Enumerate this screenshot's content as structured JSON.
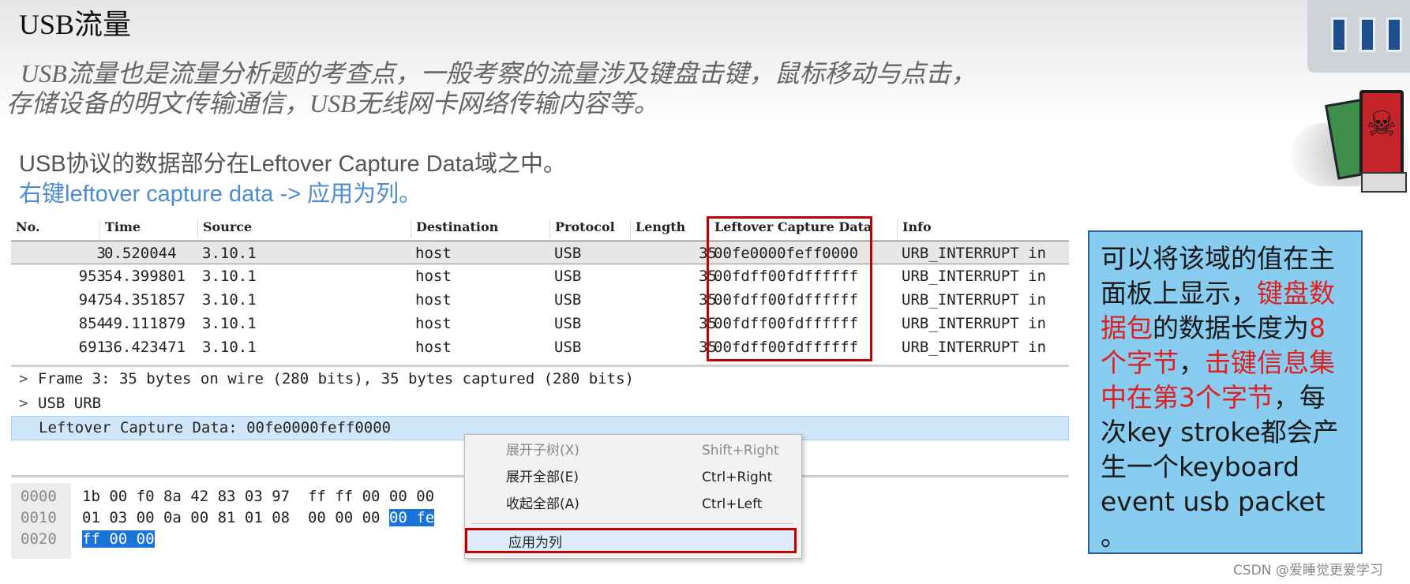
{
  "slide": {
    "title": "USB流量",
    "subtitle_line1": "USB流量也是流量分析题的考查点，一般考察的流量涉及键盘击键，鼠标移动与点击，",
    "subtitle_line2": "存储设备的明文传输通信，USB无线网卡网络传输内容等。",
    "note1": "USB协议的数据部分在Leftover Capture Data域之中。",
    "note2": "右键leftover capture data -> 应用为列。"
  },
  "packet_list": {
    "columns": [
      "No.",
      "Time",
      "Source",
      "Destination",
      "Protocol",
      "Length",
      "Leftover Capture Data",
      "Info"
    ],
    "rows": [
      {
        "no": "3",
        "time": "0.520044",
        "source": "3.10.1",
        "destination": "host",
        "protocol": "USB",
        "length": "35",
        "data": "00fe0000feff0000",
        "info": "URB_INTERRUPT in",
        "selected": true
      },
      {
        "no": "953",
        "time": "54.399801",
        "source": "3.10.1",
        "destination": "host",
        "protocol": "USB",
        "length": "35",
        "data": "00fdff00fdffffff",
        "info": "URB_INTERRUPT in",
        "selected": false
      },
      {
        "no": "947",
        "time": "54.351857",
        "source": "3.10.1",
        "destination": "host",
        "protocol": "USB",
        "length": "35",
        "data": "00fdff00fdffffff",
        "info": "URB_INTERRUPT in",
        "selected": false
      },
      {
        "no": "854",
        "time": "49.111879",
        "source": "3.10.1",
        "destination": "host",
        "protocol": "USB",
        "length": "35",
        "data": "00fdff00fdffffff",
        "info": "URB_INTERRUPT in",
        "selected": false
      },
      {
        "no": "691",
        "time": "36.423471",
        "source": "3.10.1",
        "destination": "host",
        "protocol": "USB",
        "length": "35",
        "data": "00fdff00fdffffff",
        "info": "URB_INTERRUPT in",
        "selected": false
      }
    ]
  },
  "detail_tree": {
    "frame": "Frame 3: 35 bytes on wire (280 bits), 35 bytes captured (280 bits)",
    "usb_urb": "USB URB",
    "leftover": "Leftover Capture Data: 00fe0000feff0000",
    "expand_arrow": ">"
  },
  "hex_dump": [
    {
      "offset": "0000",
      "bytes": "1b 00 f0 8a 42 83 03 97  ff ff 00 00 00",
      "selected": ""
    },
    {
      "offset": "0010",
      "bytes": "01 03 00 0a 00 81 01 08  00 00 00 ",
      "selected": "00 fe"
    },
    {
      "offset": "0020",
      "bytes": "",
      "selected": "ff 00 00"
    }
  ],
  "context_menu": {
    "items": [
      {
        "label": "展开子树(X)",
        "shortcut": "Shift+Right",
        "disabled": true
      },
      {
        "label": "展开全部(E)",
        "shortcut": "Ctrl+Right",
        "disabled": false
      },
      {
        "label": "收起全部(A)",
        "shortcut": "Ctrl+Left",
        "disabled": false
      }
    ],
    "apply_as_column": "应用为列"
  },
  "note_box": {
    "p1": "可以将该域的值在主面板上显示，",
    "p2_red": "键盘数据包",
    "p3": "的数据长度为",
    "p4_red": "8个字节",
    "p5": "，",
    "p6_red": "击键信息集中在第3个字节",
    "p7": "，每次key stroke都会产生一个keyboard event usb packet 。"
  },
  "watermark": "CSDN @爱睡觉更爱学习",
  "colors": {
    "highlight_red": "#c00000",
    "selection_blue": "#1a73d9",
    "note_bg": "#88ccf0",
    "link_blue": "#4a8ccf"
  }
}
